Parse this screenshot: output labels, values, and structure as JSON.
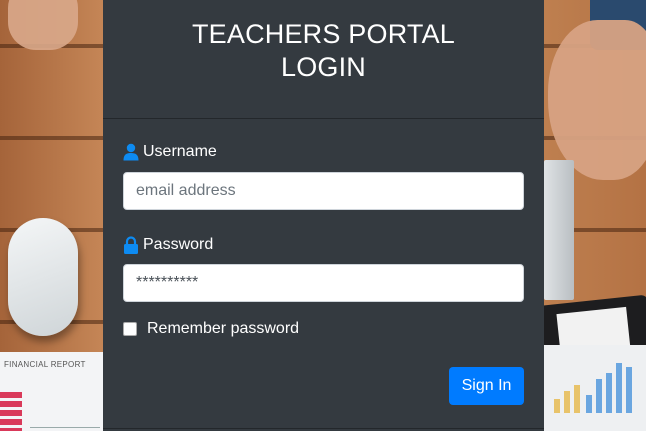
{
  "login": {
    "title_line1": "TEACHERS PORTAL",
    "title_line2": "LOGIN",
    "username_label": "Username",
    "username_placeholder": "email address",
    "password_label": "Password",
    "password_value": "**********",
    "remember_label": "Remember password",
    "signin_label": "Sign In"
  },
  "background": {
    "report_caption": "FINANCIAL REPORT"
  },
  "icons": {
    "username": "user-icon",
    "password": "lock-icon"
  },
  "colors": {
    "panel": "#343a40",
    "accent": "#007bff",
    "icon": "#0d8bf2"
  }
}
